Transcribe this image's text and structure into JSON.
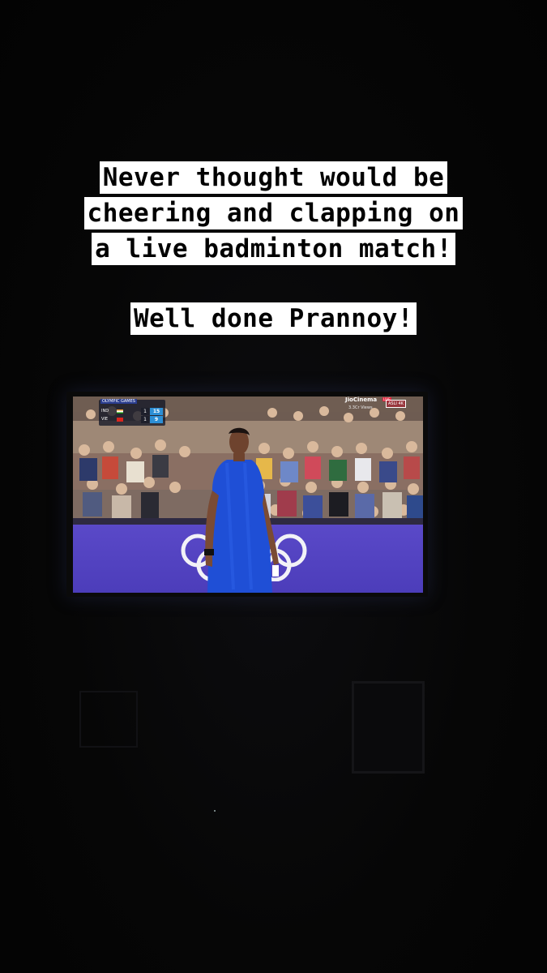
{
  "caption": {
    "lines": [
      "Never thought would be",
      "cheering and clapping on",
      "a live badminton match!",
      "Well done Prannoy!"
    ]
  },
  "tv": {
    "scoreboard": {
      "event": "OLYMPIC GAMES",
      "rows": [
        {
          "code": "IND",
          "set": "1",
          "points": "15"
        },
        {
          "code": "VIE",
          "set": "1",
          "points": "9"
        }
      ]
    },
    "broadcaster": {
      "name": "JioCinema",
      "live": "LIVE",
      "views": "3.3Cr Views",
      "badge": "ASLI 4K"
    },
    "colors": {
      "board": "#4c3dba",
      "jersey": "#1f4fd6",
      "rings": "#f2f2f7"
    }
  }
}
